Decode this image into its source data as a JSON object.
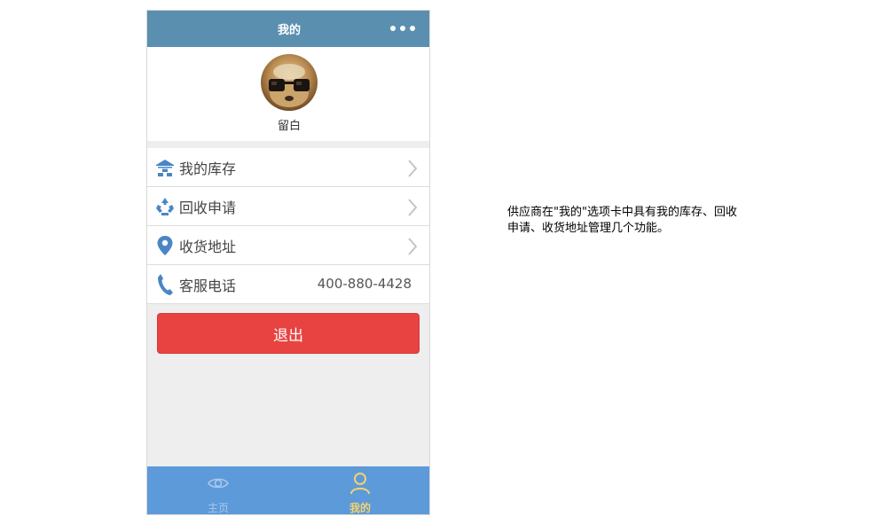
{
  "header": {
    "title": "我的"
  },
  "profile": {
    "nickname": "留白"
  },
  "menu": [
    {
      "label": "我的库存",
      "icon": "warehouse-icon"
    },
    {
      "label": "回收申请",
      "icon": "recycle-icon"
    },
    {
      "label": "收货地址",
      "icon": "location-pin-icon"
    },
    {
      "label": "客服电话",
      "icon": "phone-icon",
      "value": "400-880-4428"
    }
  ],
  "logout": {
    "label": "退出"
  },
  "tabbar": [
    {
      "label": "主页",
      "icon": "eye-icon",
      "active": false
    },
    {
      "label": "我的",
      "icon": "user-icon",
      "active": true
    }
  ],
  "note": {
    "text": "供应商在\"我的\"选项卡中具有我的库存、回收申请、收货地址管理几个功能。"
  },
  "colors": {
    "title_bar": "#5a8fb0",
    "tabbar": "#5d9ada",
    "logout": "#e84341",
    "active_tab": "#f3d36b",
    "icon_blue": "#4a86c5"
  }
}
